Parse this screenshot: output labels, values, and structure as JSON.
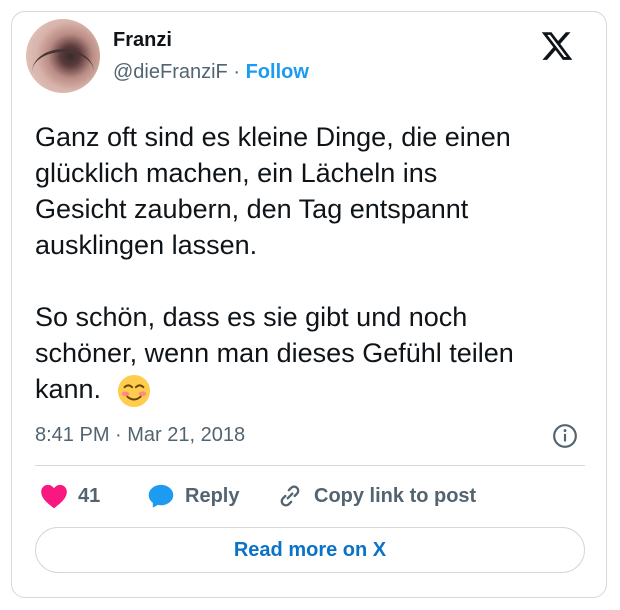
{
  "author": {
    "name": "Franzi",
    "handle": "@dieFranziF",
    "separator": "·",
    "follow_label": "Follow"
  },
  "tweet": {
    "text": "Ganz oft sind es kleine Dinge, die einen\nglücklich machen, ein Lächeln ins\nGesicht zaubern, den Tag entspannt\nausklingen lassen.\n\nSo schön, dass es sie gibt und noch\nschöner, wenn man dieses Gefühl teilen\nkann.",
    "emoji": "smiling-face-icon",
    "timestamp": "8:41 PM · Mar 21, 2018"
  },
  "actions": {
    "like_count": "41",
    "reply_label": "Reply",
    "copy_label": "Copy link to post"
  },
  "read_more_label": "Read more on X",
  "colors": {
    "accent": "#1d9bf0",
    "link_dark": "#0a73c8",
    "heart": "#f91880",
    "muted": "#536471",
    "text": "#0f1419",
    "border": "#cfd9de"
  }
}
